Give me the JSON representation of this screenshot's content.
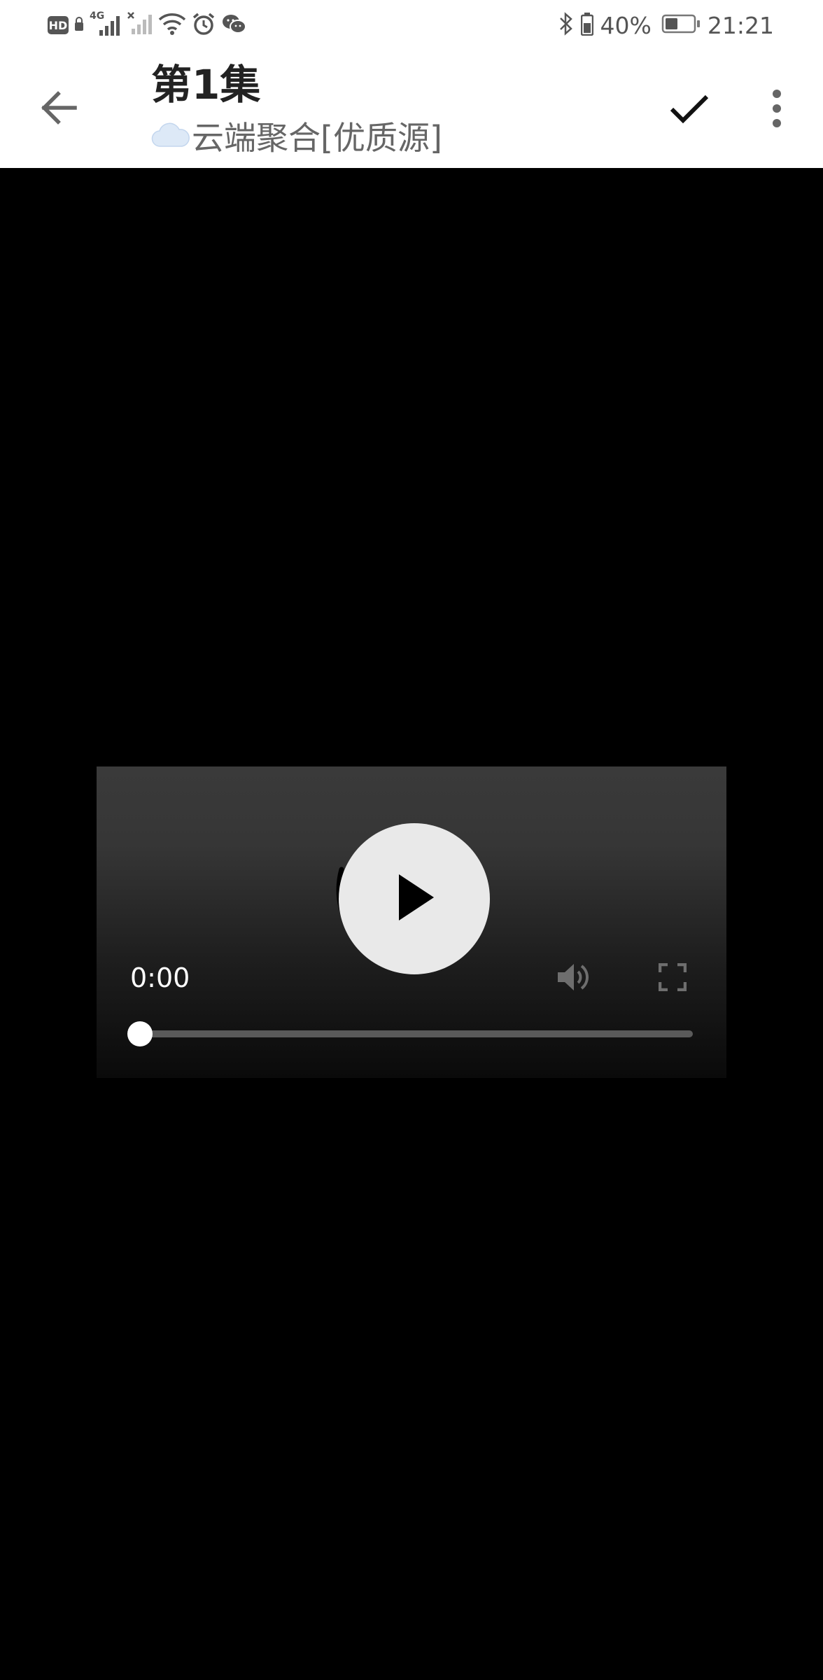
{
  "status_bar": {
    "hd_label": "HD",
    "network_label": "4G",
    "battery_percent": "40%",
    "time": "21:21",
    "icons": [
      "hd-icon",
      "lock-icon",
      "signal-icon",
      "no-signal-icon",
      "wifi-icon",
      "alarm-icon",
      "wechat-icon",
      "bluetooth-icon",
      "battery-saver-icon",
      "battery-icon"
    ]
  },
  "app_bar": {
    "title": "第1集",
    "subtitle_emoji": "☁️",
    "subtitle": "云端聚合[优质源]",
    "icons": [
      "back-arrow-icon",
      "check-icon",
      "more-vert-icon"
    ]
  },
  "player": {
    "current_time": "0:00",
    "progress": 0,
    "icons": [
      "play-icon",
      "volume-icon",
      "fullscreen-icon"
    ]
  }
}
